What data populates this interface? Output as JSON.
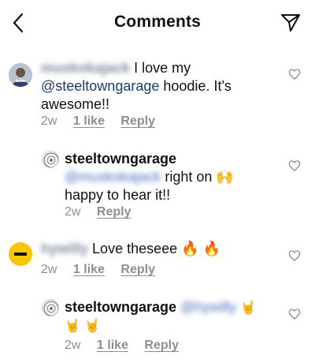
{
  "header": {
    "title": "Comments"
  },
  "comments": [
    {
      "username": "muskokajack",
      "text": "I love my",
      "mention": "@steeltowngarage",
      "text2": "hoodie. It's awesome!!",
      "age": "2w",
      "likes": "1 like",
      "reply": "Reply"
    },
    {
      "username": "steeltowngarage",
      "mention": "@muskokajack",
      "text": "right on 🙌",
      "text2": "happy to hear it!!",
      "age": "2w",
      "reply": "Reply"
    },
    {
      "username": "hywilly",
      "text": "Love theseee 🔥 🔥",
      "age": "2w",
      "likes": "1 like",
      "reply": "Reply"
    },
    {
      "username": "steeltowngarage",
      "mention": "@hywilly",
      "emoji": "🤘",
      "text2": "🤘 🤘",
      "age": "2w",
      "likes": "1 like",
      "reply": "Reply"
    }
  ],
  "icons": {
    "back": "chevron-left-icon",
    "share": "paper-plane-icon",
    "like": "heart-outline-icon"
  },
  "colors": {
    "mention": "#1d3a6e",
    "meta": "#8e8e8e",
    "avatar_yellow": "#f7c600"
  }
}
